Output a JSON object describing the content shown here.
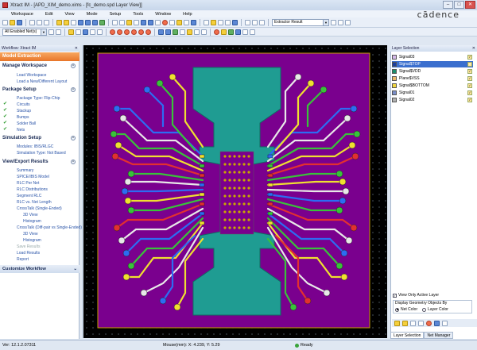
{
  "window": {
    "title": "Xtract IM - [APD_XIM_demo.xims - [fc_demo.spd Layer View]]"
  },
  "menu": [
    "Workspace",
    "Edit",
    "View",
    "Mode",
    "Setup",
    "Tools",
    "Window",
    "Help"
  ],
  "brand": "cādence",
  "toolbar": {
    "result_combo": "Extractor Result",
    "net_combo": "All Enabled Net(s)"
  },
  "workflow": {
    "panel_title": "Workflow: Xtract IM",
    "mode": "Model Extraction",
    "sections": [
      {
        "title": "Manage Workspace",
        "items": [
          "Load Workspace",
          "Load a New/Different Layout"
        ]
      },
      {
        "title": "Package Setup",
        "items": [
          "Package Type: Flip-Chip",
          "Circuits",
          "Stackup",
          "Bumps",
          "Solder Ball",
          "Nets"
        ]
      },
      {
        "title": "Simulation Setup",
        "items": [
          "Modules: IBIS/RLGC",
          "Simulation Type: Not Based"
        ]
      },
      {
        "title": "View/Export Results",
        "items": [
          "Summary",
          "SPICE/IBIS Model",
          "RLC Per Net",
          "RLC Distributions",
          "Segment RLC",
          "RLC vs. Net Length",
          "CrossTalk (Single-Ended)",
          "3D View",
          "Histogram",
          "CrossTalk (Diff-pair vs Single-Ended)",
          "3D View",
          "Histogram",
          "Save Results",
          "Load Results",
          "Report"
        ]
      }
    ],
    "customize": "Customize Workflow"
  },
  "layers": {
    "panel_title": "Layer Selection",
    "items": [
      {
        "name": "Signal03",
        "color": "#d4b8e8"
      },
      {
        "name": "Signal$TOP",
        "color": "#1b3ea0"
      },
      {
        "name": "Signal$VDD",
        "color": "#1c8c6c"
      },
      {
        "name": "Plane$VSS",
        "color": "#e9b86b"
      },
      {
        "name": "Signal$BOTTOM",
        "color": "#f0d640"
      },
      {
        "name": "Signal01",
        "color": "#7a8ec8"
      },
      {
        "name": "Signal02",
        "color": "#b0b0b0"
      }
    ],
    "selected_index": 1,
    "view_only": "View Only Active Layer",
    "display_label": "Display Geometry Objects By",
    "net_color": "Net Color",
    "layer_color": "Layer Color",
    "tabs": [
      "Layer Selection",
      "Net Manager"
    ]
  },
  "status": {
    "version": "Ver: 12.1.2.07311",
    "mouse": "Mouse(mm): X: 4.239, Y: 5.29",
    "ready": "Ready"
  }
}
